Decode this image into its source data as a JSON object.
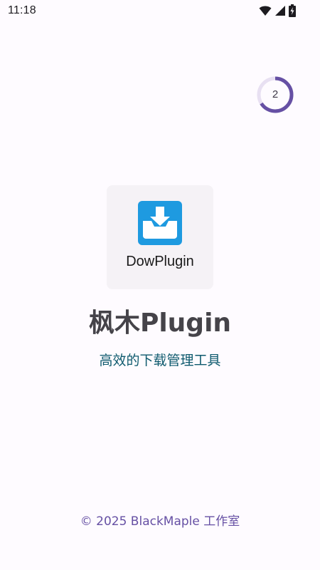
{
  "status_bar": {
    "time": "11:18",
    "icons": [
      "wifi-icon",
      "cell-signal-icon",
      "battery-charging-icon"
    ]
  },
  "splash": {
    "countdown": {
      "value": "2",
      "progress_fraction": 0.66,
      "track_color": "#e8e0f2",
      "progress_color": "#6650a4"
    },
    "logo": {
      "text": "DowPlugin",
      "icon": "download-tray-icon",
      "icon_color": "#1e9ae0"
    },
    "title": "枫木Plugin",
    "subtitle": "高效的下载管理工具",
    "copyright": "© 2025 BlackMaple 工作室"
  },
  "colors": {
    "background": "#fefbff",
    "title": "#454349",
    "subtitle": "#0e5a6e",
    "accent": "#6650a4"
  }
}
